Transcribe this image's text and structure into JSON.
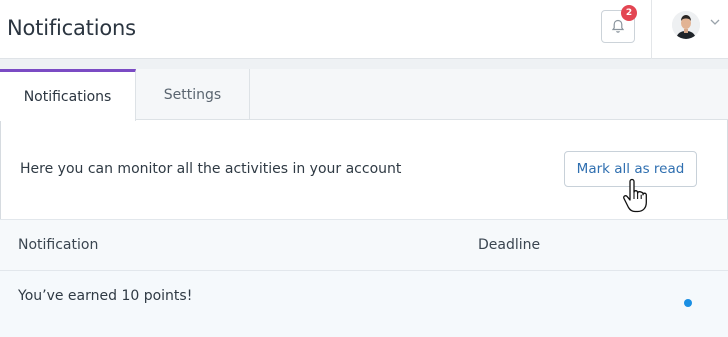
{
  "header": {
    "title": "Notifications",
    "notification_count": "2"
  },
  "tabs": [
    {
      "label": "Notifications",
      "active": true
    },
    {
      "label": "Settings",
      "active": false
    }
  ],
  "info": {
    "text": "Here you can monitor all the activities in your account",
    "mark_all_label": "Mark all as read"
  },
  "table": {
    "columns": [
      "Notification",
      "Deadline"
    ],
    "rows": [
      {
        "notification": "You’ve earned 10 points!",
        "deadline": "",
        "unread": true
      }
    ]
  },
  "colors": {
    "accent": "#7b4bc4",
    "badge": "#e34552",
    "unread_dot": "#1a8fe3",
    "link": "#2f6fb0"
  }
}
